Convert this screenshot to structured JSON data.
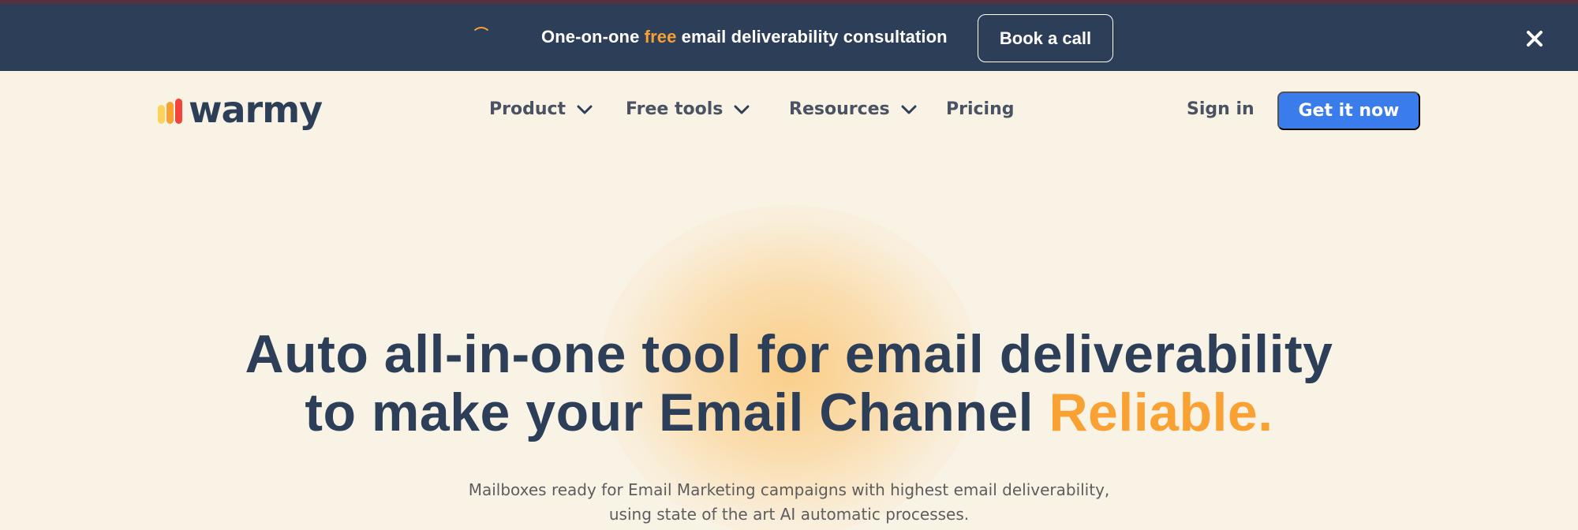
{
  "announcement": {
    "text_before": "One-on-one ",
    "text_highlight": "free",
    "text_after": " email deliverability consultation",
    "button_label": "Book a call",
    "highlight_color": "#f59f35",
    "background_color": "#2d3f58"
  },
  "nav": {
    "logo_text": "warmy",
    "logo_colors": [
      "#fdd35c",
      "#f9a132",
      "#f2443b"
    ],
    "items": [
      {
        "label": "Product",
        "has_dropdown": true
      },
      {
        "label": "Free tools",
        "has_dropdown": true
      },
      {
        "label": "Resources",
        "has_dropdown": true
      },
      {
        "label": "Pricing",
        "has_dropdown": false
      }
    ],
    "sign_in": "Sign in",
    "cta": "Get it now",
    "cta_color": "#3b7ced"
  },
  "hero": {
    "title_line1": "Auto all-in-one tool for email deliverability",
    "title_line2_prefix": "to make your Email Channel ",
    "title_accent": "Reliable.",
    "accent_color": "#f9a132",
    "subtitle_line1": "Mailboxes ready for Email Marketing campaigns with highest email deliverability,",
    "subtitle_line2": "using state of the art AI automatic processes."
  }
}
